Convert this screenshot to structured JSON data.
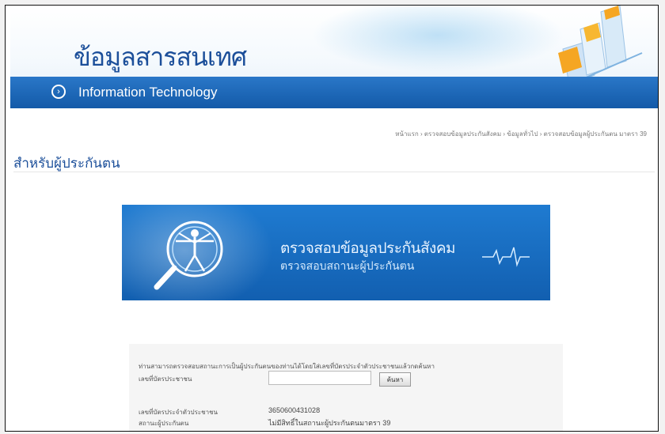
{
  "header": {
    "thai_title": "ข้อมูลสารสนเทศ",
    "en_title": "Information Technology"
  },
  "breadcrumb": "หน้าแรก › ตรวจสอบข้อมูลประกันสังคม › ข้อมูลทั่วไป › ตรวจสอบข้อมูลผู้ประกันตน มาตรา 39",
  "section": {
    "title": "สำหรับผู้ประกันตน"
  },
  "promo": {
    "line1": "ตรวจสอบข้อมูลประกันสังคม",
    "line2": "ตรวจสอบสถานะผู้ประกันตน"
  },
  "form": {
    "note": "ท่านสามารถตรวจสอบสถานะการเป็นผู้ประกันตนของท่านได้โดยใส่เลขที่บัตรประจำตัวประชาชนแล้วกดค้นหา",
    "id_label": "เลขที่บัตรประชาชน",
    "id_value": "",
    "search_button": "ค้นหา",
    "results": [
      {
        "label": "เลขที่บัตรประจำตัวประชาชน",
        "value": "3650600431028"
      },
      {
        "label": "สถานะผู้ประกันตน",
        "value": "ไม่มีสิทธิ์ในสถานะผู้ประกันตนมาตรา 39"
      }
    ]
  },
  "colors": {
    "brand_blue": "#1c4f9a",
    "bar_blue": "#1a64b4",
    "promo_blue": "#1a6dc2"
  },
  "icons": [
    "arrow-circle-icon",
    "bar-chart-decoration",
    "vitruvian-magnifier-icon",
    "heartbeat-line-icon"
  ]
}
